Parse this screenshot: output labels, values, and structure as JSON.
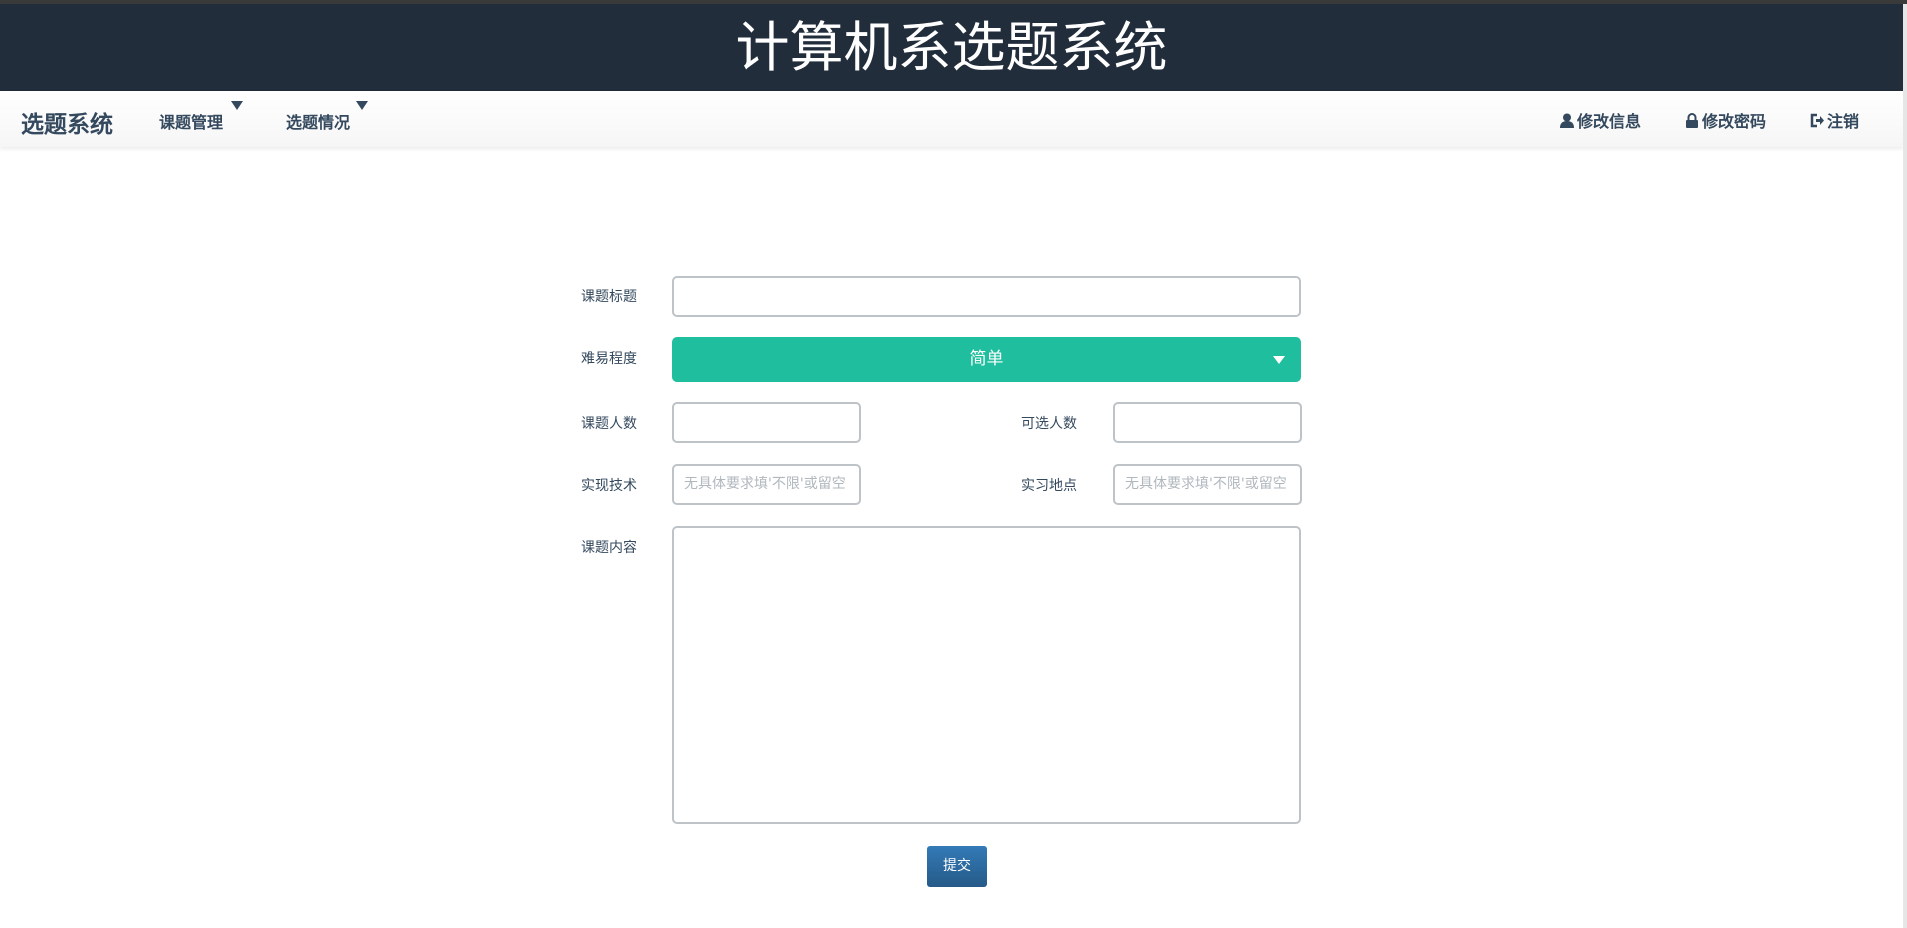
{
  "header": {
    "title": "计算机系选题系统"
  },
  "nav": {
    "brand": "选题系统",
    "items": [
      {
        "label": "课题管理"
      },
      {
        "label": "选题情况"
      }
    ],
    "right": [
      {
        "label": "修改信息",
        "icon": "user-icon"
      },
      {
        "label": "修改密码",
        "icon": "lock-icon"
      },
      {
        "label": "注销",
        "icon": "logout-icon"
      }
    ]
  },
  "form": {
    "title_label": "课题标题",
    "title_value": "",
    "difficulty_label": "难易程度",
    "difficulty_value": "简单",
    "count_label": "课题人数",
    "count_value": "",
    "selectable_label": "可选人数",
    "selectable_value": "",
    "tech_label": "实现技术",
    "tech_placeholder": "无具体要求填'不限'或留空",
    "location_label": "实习地点",
    "location_placeholder": "无具体要求填'不限'或留空",
    "content_label": "课题内容",
    "content_value": "",
    "submit_label": "提交"
  },
  "colors": {
    "header_bg": "#212d3b",
    "select_bg": "#1fbe9e",
    "submit_bg": "#2d6ca2"
  }
}
